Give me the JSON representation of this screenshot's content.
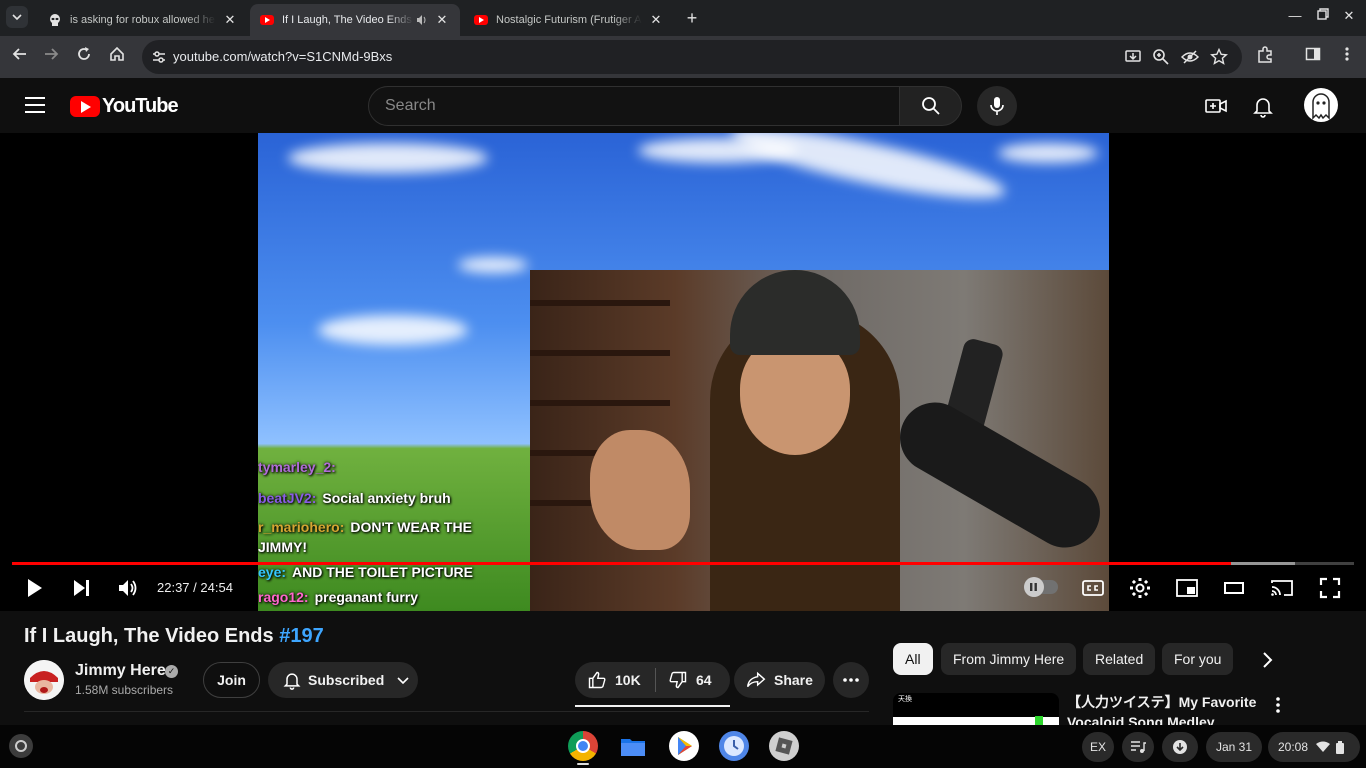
{
  "browser": {
    "tabs": [
      {
        "title": "is asking for robux allowed her",
        "active": false
      },
      {
        "title": "If I Laugh, The Video Ends #",
        "active": true
      },
      {
        "title": "Nostalgic Futurism (Frutiger Ae",
        "active": false
      }
    ],
    "url": "youtube.com/watch?v=S1CNMd-9Bxs"
  },
  "youtube": {
    "logo_text": "YouTube",
    "search_placeholder": "Search",
    "player": {
      "time_current": "22:37",
      "time_separator": " / ",
      "time_total": "24:54",
      "progress_fraction": 0.9087,
      "buffered_fraction": 0.956
    },
    "stream_chat": [
      {
        "user": "tymarley_2:",
        "msg": "",
        "color": "#b06cd8"
      },
      {
        "user": "beatJV2:",
        "msg": "Social anxiety bruh",
        "color": "#8a5ce6"
      },
      {
        "user": "r_mariohero:",
        "msg": "DON'T WEAR THE",
        "color": "#d5a531"
      },
      {
        "user": "",
        "msg": "JIMMY!",
        "color": "#ffffff"
      },
      {
        "user": "eye:",
        "msg": "AND THE TOILET PICTURE",
        "color": "#36c7ff"
      },
      {
        "user": "rago12:",
        "msg": "preganant furry",
        "color": "#ff66cc"
      }
    ],
    "video": {
      "title": "If I Laugh, The Video Ends ",
      "title_tag": "#197",
      "channel": "Jimmy Here",
      "subscribers": "1.58M subscribers",
      "join_label": "Join",
      "subscribed_label": "Subscribed",
      "likes": "10K",
      "dislikes": "64",
      "share_label": "Share"
    },
    "chips": [
      "All",
      "From Jimmy Here",
      "Related",
      "For you"
    ],
    "recommendation": {
      "title": "【人力ツイステ】My Favorite Vocaloid Song Medley EXTEND",
      "thumb_label": "天換"
    }
  },
  "shelf": {
    "ime": "EX",
    "date": "Jan 31",
    "time": "20:08"
  },
  "colors": {
    "yt_red": "#ff0000",
    "accent_blue": "#3ea6ff"
  }
}
